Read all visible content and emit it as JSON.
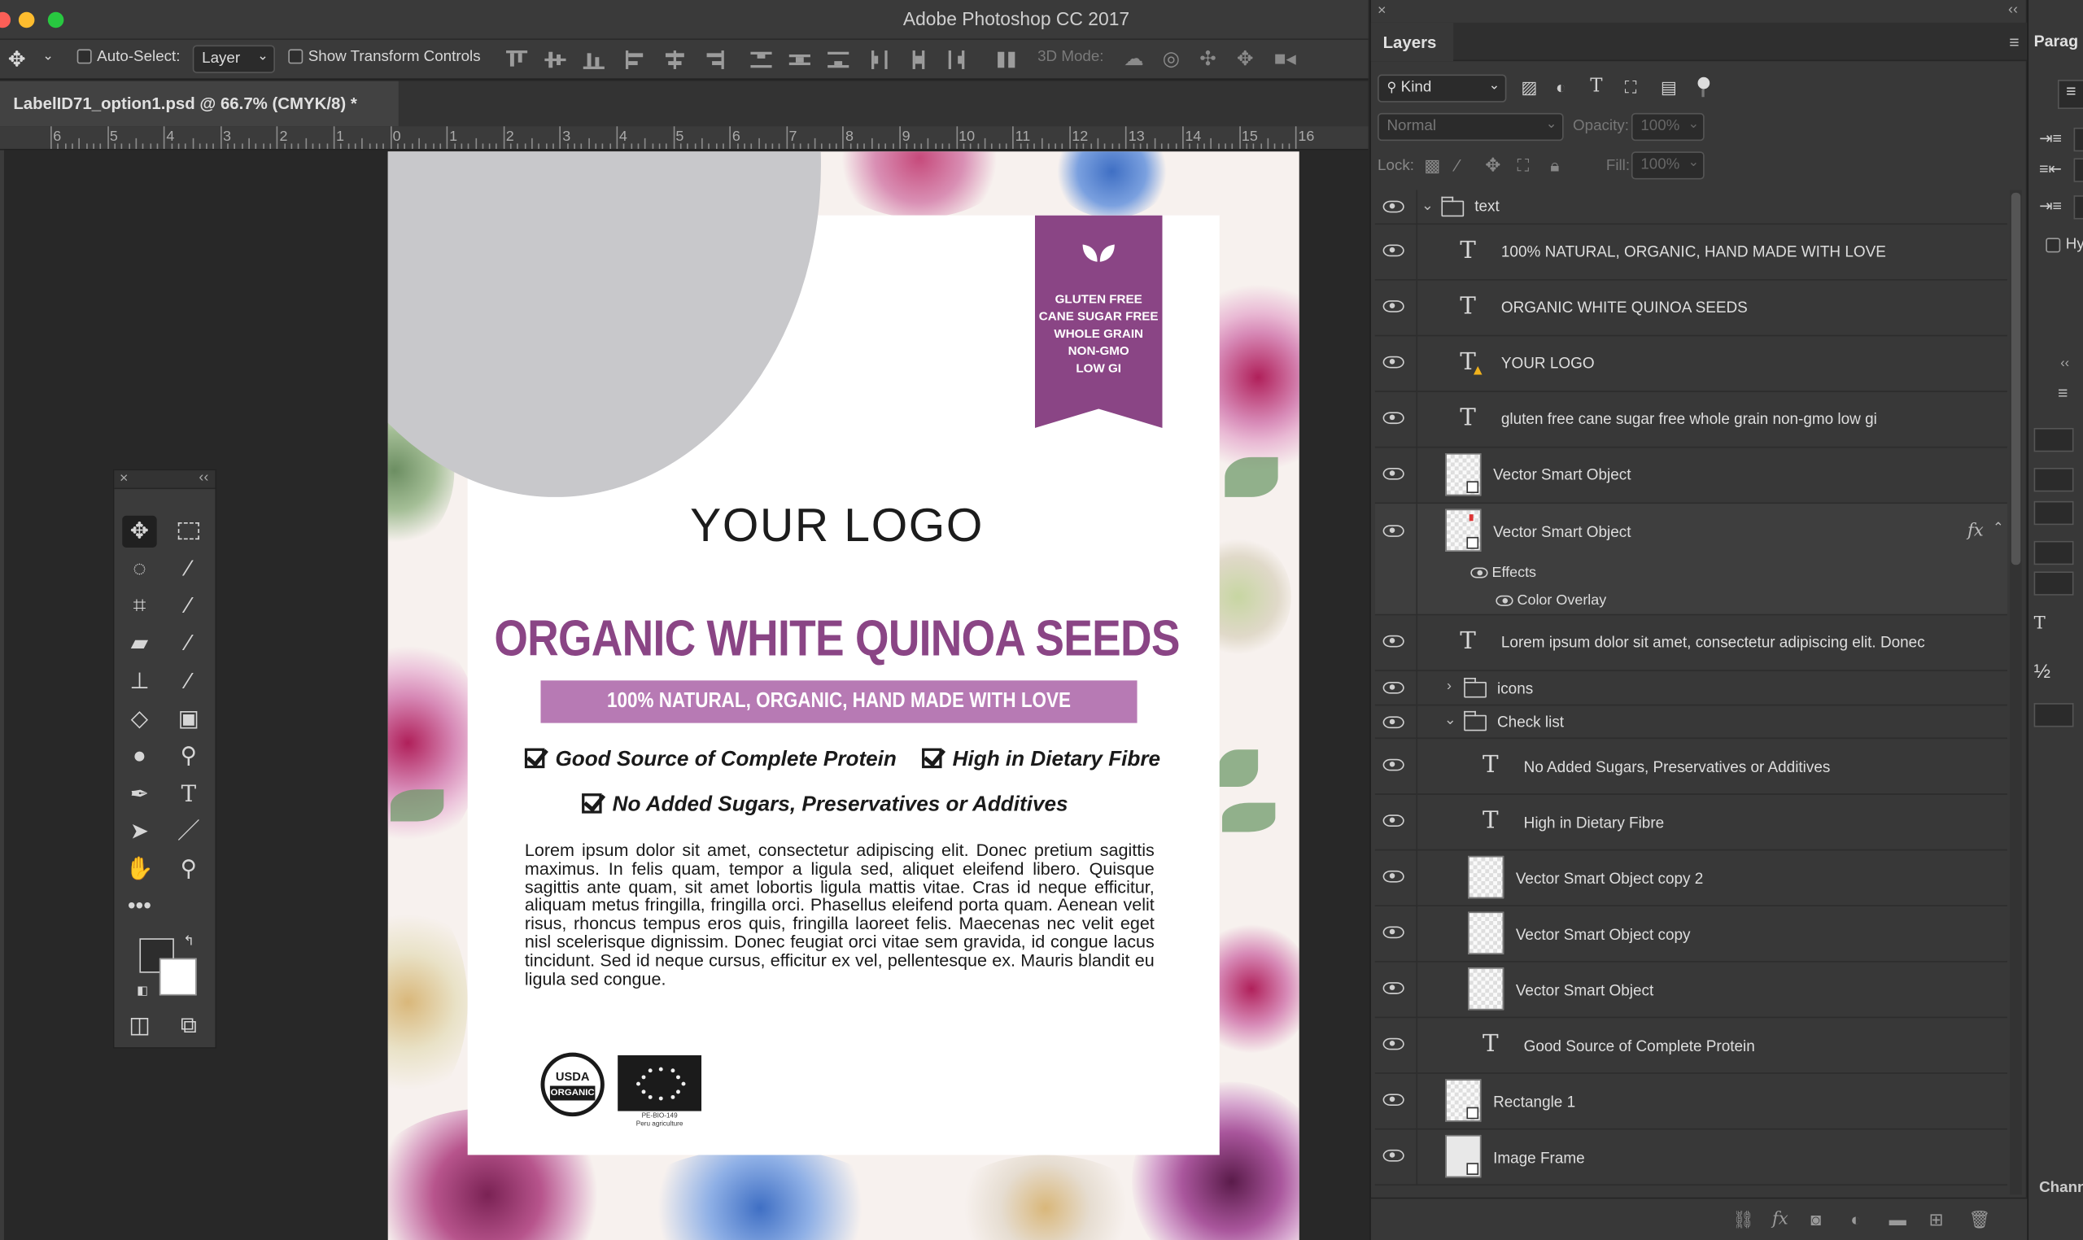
{
  "app": {
    "title": "Adobe Photoshop CC 2017"
  },
  "options_bar": {
    "auto_select_label": "Auto-Select:",
    "auto_select_value": "Layer",
    "transform_controls_label": "Show Transform Controls",
    "mode_3d_label": "3D Mode:"
  },
  "document": {
    "tab_title": "LabelID71_option1.psd @ 66.7% (CMYK/8) *"
  },
  "ruler": {
    "labels": [
      "6",
      "5",
      "4",
      "3",
      "2",
      "1",
      "0",
      "1",
      "2",
      "3",
      "4",
      "5",
      "6",
      "7",
      "8",
      "9",
      "10",
      "11",
      "12",
      "13",
      "14",
      "15",
      "16"
    ]
  },
  "label": {
    "ribbon_lines": [
      "GLUTEN FREE",
      "CANE SUGAR FREE",
      "WHOLE GRAIN",
      "NON-GMO",
      "LOW GI"
    ],
    "logo": "YOUR LOGO",
    "product_title": "ORGANIC WHITE QUINOA SEEDS",
    "banner": "100% NATURAL, ORGANIC, HAND MADE WITH LOVE",
    "check_1": "Good Source of Complete Protein",
    "check_2": "High in Dietary Fibre",
    "check_3": "No Added Sugars, Preservatives or Additives",
    "body": "Lorem ipsum dolor sit amet, consectetur adipiscing elit. Donec pretium sagittis maximus. In felis quam, tempor a ligula sed, aliquet eleifend libero. Quisque sagittis ante quam, sit amet lobortis ligula mattis vitae. Cras id neque efficitur, aliquam metus fringilla, fringilla orci. Phasellus eleifend porta quam. Aenean velit risus, rhoncus tempus eros quis, fringilla laoreet felis. Maecenas nec velit eget nisl scelerisque dignissim. Donec feugiat orci vitae sem gravida, id congue lacus tincidunt. Sed id neque cursus, efficitur ex vel, pellentesque ex. Mauris blandit eu ligula sed congue.",
    "usda_top": "USDA",
    "usda_bottom": "ORGANIC",
    "eu_caption_1": "PE-BIO-149",
    "eu_caption_2": "Peru agriculture"
  },
  "layers_panel": {
    "tab": "Layers",
    "filter_kind": "Kind",
    "blend_mode": "Normal",
    "opacity_label": "Opacity:",
    "opacity_value": "100%",
    "lock_label": "Lock:",
    "fill_label": "Fill:",
    "fill_value": "100%",
    "layers": [
      {
        "name": "text"
      },
      {
        "name": "100% NATURAL, ORGANIC, HAND MADE WITH LOVE"
      },
      {
        "name": "ORGANIC WHITE QUINOA SEEDS"
      },
      {
        "name": "YOUR LOGO"
      },
      {
        "name": "gluten free cane sugar free whole grain non-gmo low gi"
      },
      {
        "name": "Vector Smart Object"
      },
      {
        "name": "Vector Smart Object"
      },
      {
        "name": "Effects"
      },
      {
        "name": "Color Overlay"
      },
      {
        "name": "Lorem ipsum dolor sit amet, consectetur adipiscing elit. Donec"
      },
      {
        "name": "icons"
      },
      {
        "name": "Check list"
      },
      {
        "name": "No Added Sugars, Preservatives or Additives"
      },
      {
        "name": "High in Dietary Fibre"
      },
      {
        "name": "Vector Smart Object copy 2"
      },
      {
        "name": "Vector Smart Object copy"
      },
      {
        "name": "Vector Smart Object"
      },
      {
        "name": "Good Source of Complete Protein"
      },
      {
        "name": "Rectangle 1"
      },
      {
        "name": "Image Frame"
      }
    ]
  },
  "paragraph_panel": {
    "tab": "Parag",
    "hy_label": "Hy",
    "bottom_tab": "Chann",
    "half_glyph": "½"
  },
  "colors": {
    "accent_purple": "#8a4585",
    "banner_purple": "#b77ab4",
    "placeholder_gray": "#c8c8cb"
  }
}
